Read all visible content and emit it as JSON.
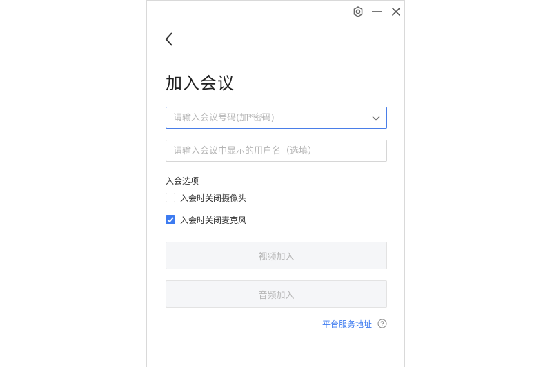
{
  "window": {
    "controls": {
      "settings_icon": "gear-icon",
      "minimize_icon": "minimize-icon",
      "close_icon": "close-icon"
    },
    "back_icon": "chevron-left-icon"
  },
  "page": {
    "title": "加入会议"
  },
  "form": {
    "meeting_id": {
      "value": "",
      "placeholder": "请输入会议号码(加*密码)"
    },
    "display_name": {
      "value": "",
      "placeholder": "请输入会议中显示的用户名（选填）"
    }
  },
  "options": {
    "section_label": "入会选项",
    "items": [
      {
        "label": "入会时关闭摄像头",
        "checked": false
      },
      {
        "label": "入会时关闭麦克风",
        "checked": true
      }
    ]
  },
  "actions": {
    "video_join": "视频加入",
    "audio_join": "音频加入"
  },
  "footer": {
    "server_link": "平台服务地址",
    "help_icon": "question-circle-icon"
  },
  "colors": {
    "accent": "#3d7bf0",
    "focus_border": "#4a7ee8",
    "disabled_text": "#b7b7b7",
    "disabled_bg": "#f5f6f8"
  }
}
